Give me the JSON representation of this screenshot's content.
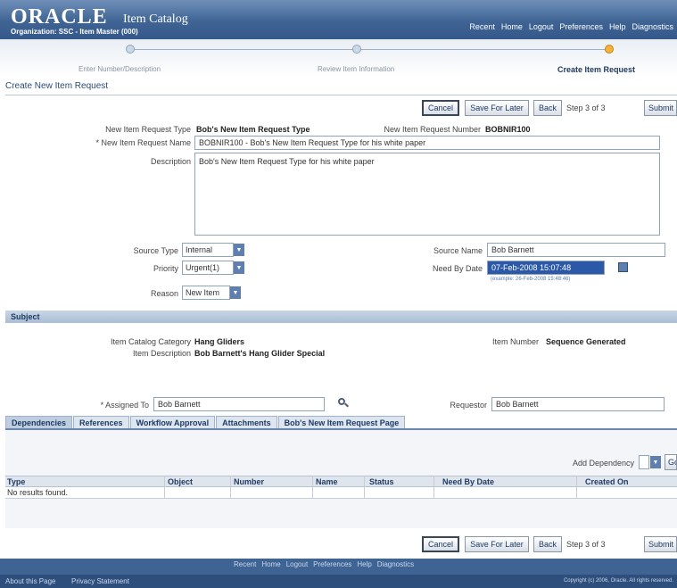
{
  "header": {
    "logo": "ORACLE",
    "app_title": "Item Catalog",
    "organization": "Organization: SSC - Item Master (000)",
    "links": [
      "Recent",
      "Home",
      "Logout",
      "Preferences",
      "Help",
      "Diagnostics"
    ]
  },
  "train": {
    "steps": [
      {
        "label": "Enter Number/Description",
        "active": false
      },
      {
        "label": "Review Item Information",
        "active": false
      },
      {
        "label": "Create Item Request",
        "active": true
      }
    ]
  },
  "page_title": "Create New Item Request",
  "actions": {
    "cancel": "Cancel",
    "save_for_later": "Save For Later",
    "back": "Back",
    "step": "Step 3 of 3",
    "submit": "Submit"
  },
  "form": {
    "request_type_label": "New Item Request Type",
    "request_type_value": "Bob's New Item Request Type",
    "request_number_label": "New Item Request Number",
    "request_number_value": "BOBNIR100",
    "request_name_label": "* New Item Request Name",
    "request_name_value": "BOBNIR100 - Bob's New Item Request Type for his white paper",
    "description_label": "Description",
    "description_value": "Bob's New Item Request Type for his white paper",
    "source_type_label": "Source Type",
    "source_type_value": "Internal",
    "source_name_label": "Source Name",
    "source_name_value": "Bob Barnett",
    "priority_label": "Priority",
    "priority_value": "Urgent(1)",
    "need_by_label": "Need By Date",
    "need_by_value": "07-Feb-2008 15:07:48",
    "need_by_hint": "(example: 26-Feb-2008 15:48:46)",
    "reason_label": "Reason",
    "reason_value": "New Item"
  },
  "subject": {
    "title": "Subject",
    "category_label": "Item Catalog Category",
    "category_value": "Hang Gliders",
    "description_label": "Item Description",
    "description_value": "Bob Barnett's Hang Glider Special",
    "item_number_label": "Item Number",
    "item_number_value": "Sequence Generated"
  },
  "assignment": {
    "assigned_to_label": "* Assigned To",
    "assigned_to_value": "Bob Barnett",
    "requestor_label": "Requestor",
    "requestor_value": "Bob Barnett"
  },
  "tabs": [
    {
      "label": "Dependencies",
      "active": true
    },
    {
      "label": "References",
      "active": false
    },
    {
      "label": "Workflow Approval",
      "active": false
    },
    {
      "label": "Attachments",
      "active": false
    },
    {
      "label": "Bob's New Item Request Page",
      "active": false
    }
  ],
  "dependencies": {
    "add_label": "Add Dependency",
    "go": "Go",
    "columns": [
      "Type",
      "Object",
      "Number",
      "Name",
      "Status",
      "Need By Date",
      "Created On"
    ],
    "empty": "No results found."
  },
  "footer": {
    "links": [
      "Recent",
      "Home",
      "Logout",
      "Preferences",
      "Help",
      "Diagnostics"
    ],
    "about": "About this Page",
    "privacy": "Privacy Statement",
    "copyright": "Copyright (c) 2006, Oracle. All rights reserved."
  }
}
